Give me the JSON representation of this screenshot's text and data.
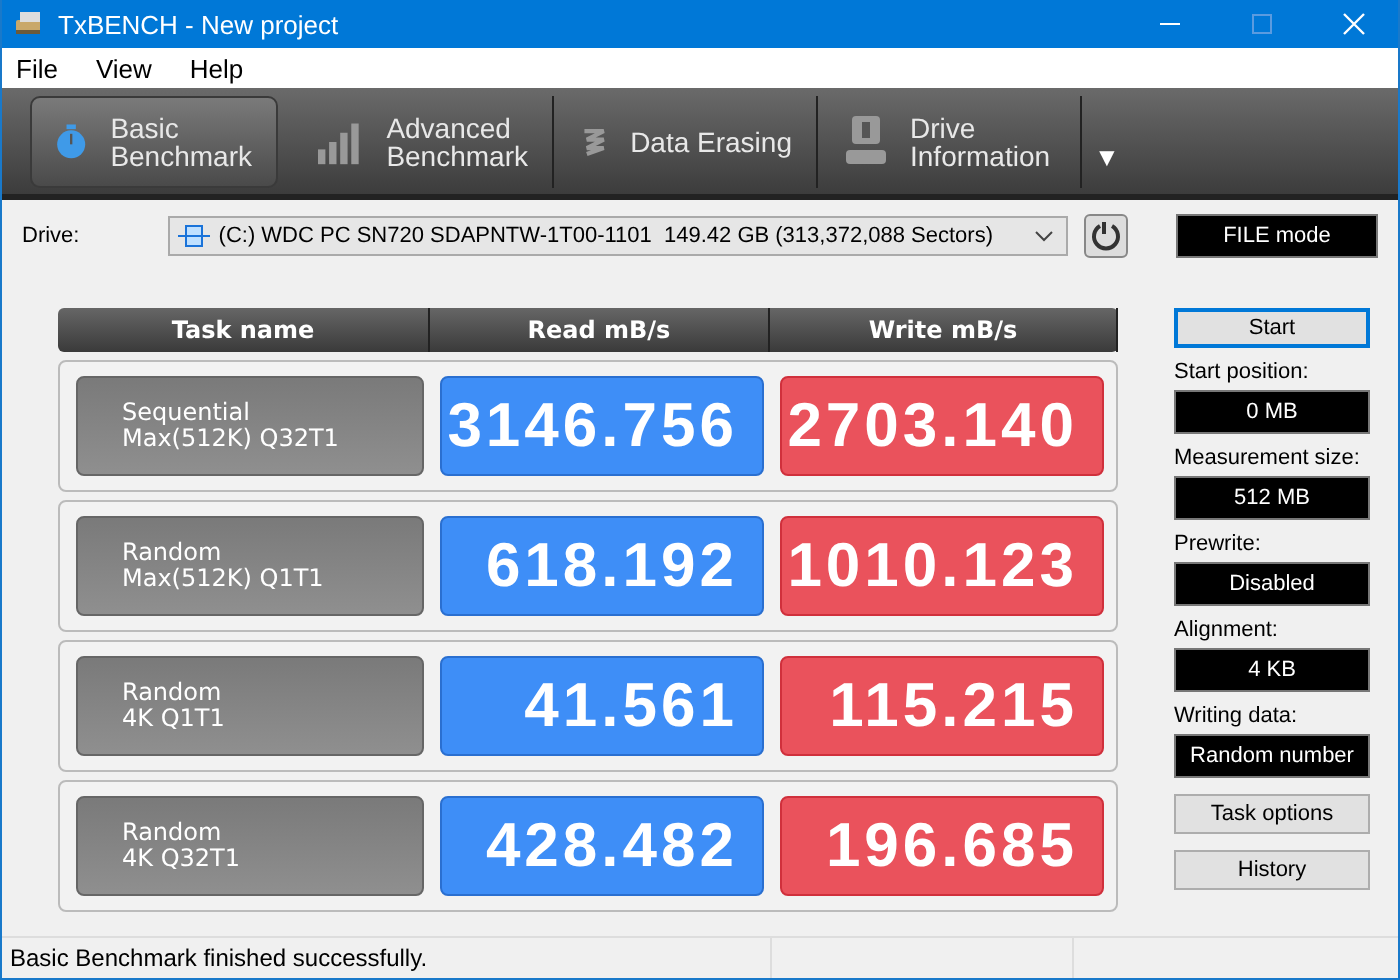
{
  "window": {
    "title": "TxBENCH - New project"
  },
  "menu": [
    "File",
    "View",
    "Help"
  ],
  "tabs": [
    {
      "label": "Basic\nBenchmark",
      "kind": "stopwatch",
      "selected": true
    },
    {
      "label": "Advanced\nBenchmark",
      "kind": "bars",
      "selected": false
    },
    {
      "label": "Data Erasing",
      "kind": "erase",
      "selected": false
    },
    {
      "label": "Drive\nInformation",
      "kind": "drive",
      "selected": false
    }
  ],
  "tabs_more": "▼",
  "drive": {
    "label": "Drive:",
    "value": "(C:) WDC PC SN720 SDAPNTW-1T00-1101  149.42 GB (313,372,088 Sectors)"
  },
  "mode": "FILE mode",
  "table": {
    "columns": [
      "Task name",
      "Read mB/s",
      "Write mB/s"
    ],
    "rows": [
      {
        "task": "Sequential\nMax(512K) Q32T1",
        "read": "3146.756",
        "write": "2703.140"
      },
      {
        "task": "Random\nMax(512K) Q1T1",
        "read": "618.192",
        "write": "1010.123"
      },
      {
        "task": "Random\n4K Q1T1",
        "read": "41.561",
        "write": "115.215"
      },
      {
        "task": "Random\n4K Q32T1",
        "read": "428.482",
        "write": "196.685"
      }
    ]
  },
  "start_button": {
    "label": "Start",
    "focused": true
  },
  "settings": [
    {
      "label": "Start position:",
      "value": "0 MB"
    },
    {
      "label": "Measurement size:",
      "value": "512 MB"
    },
    {
      "label": "Prewrite:",
      "value": "Disabled"
    },
    {
      "label": "Alignment:",
      "value": "4 KB"
    },
    {
      "label": "Writing data:",
      "value": "Random number"
    }
  ],
  "buttons": [
    "Task options",
    "History"
  ],
  "status_bar": "Basic Benchmark finished successfully."
}
